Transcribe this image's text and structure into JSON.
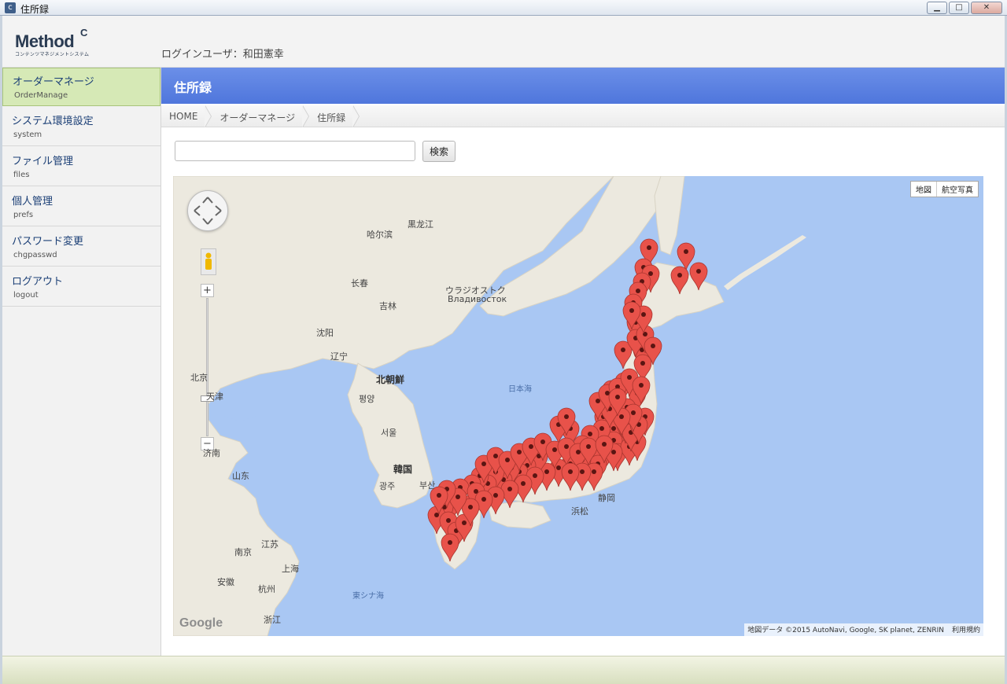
{
  "window": {
    "title": "住所録",
    "icon": "c",
    "buttons": [
      "minimize",
      "maximize",
      "close"
    ]
  },
  "header": {
    "logo_text": "Method",
    "logo_mark": "C",
    "logo_sub": "コンテンツマネジメントシステム",
    "login_user": "ログインユーザ：和田憲幸"
  },
  "sidebar": {
    "items": [
      {
        "label": "オーダーマネージ",
        "sub": "OrderManage",
        "active": true
      },
      {
        "label": "システム環境設定",
        "sub": "system",
        "active": false
      },
      {
        "label": "ファイル管理",
        "sub": "files",
        "active": false
      },
      {
        "label": "個人管理",
        "sub": "prefs",
        "active": false
      },
      {
        "label": "パスワード変更",
        "sub": "chgpasswd",
        "active": false
      },
      {
        "label": "ログアウト",
        "sub": "logout",
        "active": false
      }
    ]
  },
  "page": {
    "title": "住所録"
  },
  "breadcrumb": [
    "HOME",
    "オーダーマネージ",
    "住所録"
  ],
  "search": {
    "value": "",
    "placeholder": "",
    "button_label": "検索"
  },
  "map": {
    "type_buttons": [
      "地図",
      "航空写真"
    ],
    "labels": {
      "heilongjiang": "黒龙江",
      "harbin": "哈尔滨",
      "changchun": "长春",
      "jilin": "吉林",
      "vladivostok_ja": "ウラジオストク",
      "vladivostok_ru": "Владивосток",
      "shenyang": "沈阳",
      "liaoning": "辽宁",
      "north_korea": "北朝鮮",
      "pyongyang": "평양",
      "seoul": "서울",
      "south_korea": "韓国",
      "gwangju": "광주",
      "busan": "부산",
      "sea_of_japan": "日本海",
      "east_china_sea": "東シナ海",
      "beijing": "北京",
      "tianjin": "天津",
      "jinan": "济南",
      "shandong": "山东",
      "jiangsu": "江苏",
      "nanjing": "南京",
      "shanghai": "上海",
      "hangzhou": "杭州",
      "anhui": "安徽",
      "zhejiang": "浙江",
      "shizuoka": "静岡",
      "hamamatsu": "浜松"
    },
    "google_logo": "Google",
    "attribution": "地図データ ©2015 AutoNavi, Google, SK planet, ZENRIN",
    "terms": "利用規約",
    "zoom_in": "+",
    "zoom_out": "−",
    "colors": {
      "water": "#a9c7f3",
      "land": "#ece9df",
      "marker": "#e8524a",
      "header": "#5b80e2",
      "active_nav": "#d6e9b6"
    }
  }
}
